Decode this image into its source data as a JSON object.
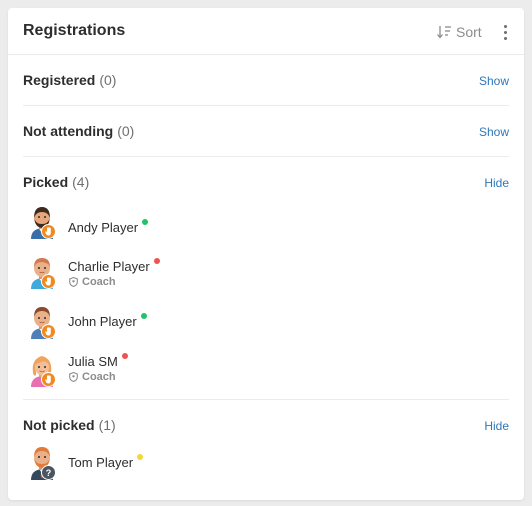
{
  "header": {
    "title": "Registrations",
    "sort_label": "Sort"
  },
  "colors": {
    "online": "#21c26b",
    "offline": "#ef5350",
    "pending": "#f5d638",
    "link": "#2f78b9",
    "badge": "#f08a1f"
  },
  "sections": {
    "registered": {
      "label": "Registered",
      "count": "(0)",
      "toggle": "Show"
    },
    "not_attending": {
      "label": "Not attending",
      "count": "(0)",
      "toggle": "Show"
    },
    "picked": {
      "label": "Picked",
      "count": "(4)",
      "toggle": "Hide",
      "players": [
        {
          "name": "Andy Player",
          "role": "",
          "status": "online",
          "badge": "hand-icon"
        },
        {
          "name": "Charlie Player",
          "role": "Coach",
          "status": "offline",
          "badge": "hand-icon"
        },
        {
          "name": "John Player",
          "role": "",
          "status": "online",
          "badge": "hand-icon"
        },
        {
          "name": "Julia SM",
          "role": "Coach",
          "status": "offline",
          "badge": "hand-icon"
        }
      ]
    },
    "not_picked": {
      "label": "Not picked",
      "count": "(1)",
      "toggle": "Hide",
      "players": [
        {
          "name": "Tom Player",
          "role": "",
          "status": "pending",
          "badge": "question-icon",
          "badge_text": "?"
        }
      ]
    }
  }
}
